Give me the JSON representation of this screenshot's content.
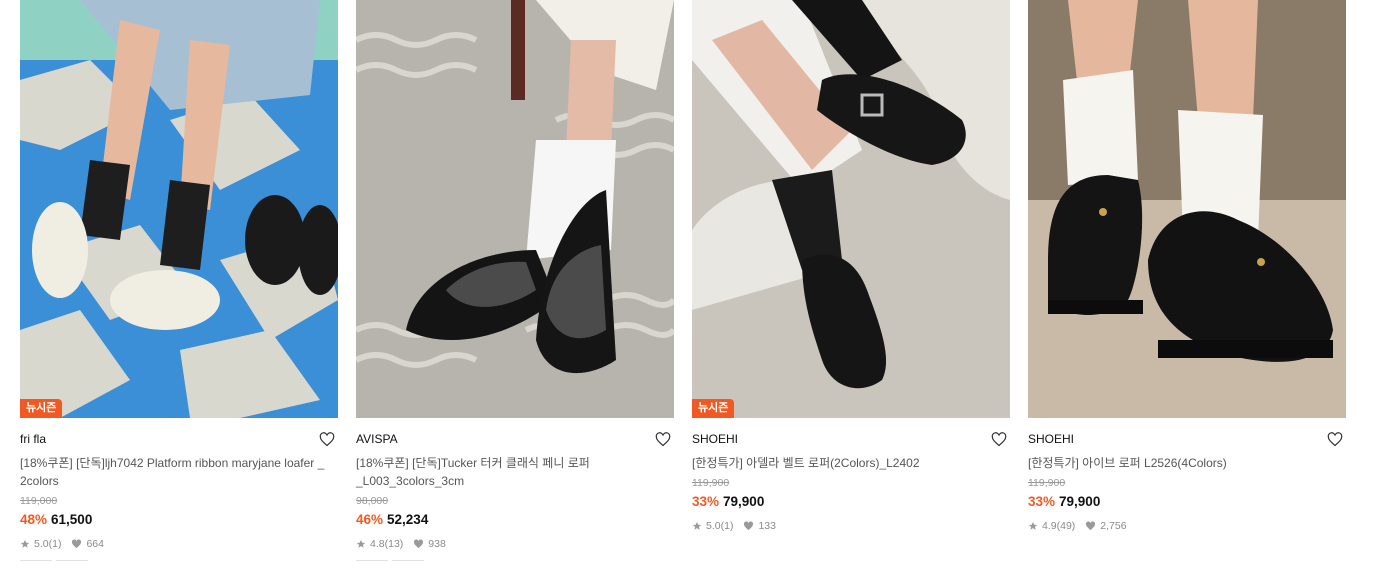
{
  "products": [
    {
      "brand": "fri fla",
      "badge": "뉴시즌",
      "name": "[18%쿠폰] [단독]ljh7042 Platform ribbon maryjane loafer _ 2colors",
      "original_price": "119,000",
      "discount": "48%",
      "price": "61,500",
      "rating": "5.0",
      "review_count": "(1)",
      "likes": "664",
      "icons": {
        "wish": "heart-outline-icon",
        "rating": "star-icon",
        "likes": "heart-filled-icon"
      }
    },
    {
      "brand": "AVISPA",
      "badge": "",
      "name": "[18%쿠폰] [단독]Tucker 터커 클래식 페니 로퍼 _L003_3colors_3cm",
      "original_price": "98,000",
      "discount": "46%",
      "price": "52,234",
      "rating": "4.8",
      "review_count": "(13)",
      "likes": "938",
      "icons": {
        "wish": "heart-outline-icon",
        "rating": "star-icon",
        "likes": "heart-filled-icon"
      }
    },
    {
      "brand": "SHOEHI",
      "badge": "뉴시즌",
      "name": "[한정특가] 아델라 벨트 로퍼(2Colors)_L2402",
      "original_price": "119,900",
      "discount": "33%",
      "price": "79,900",
      "rating": "5.0",
      "review_count": "(1)",
      "likes": "133",
      "icons": {
        "wish": "heart-outline-icon",
        "rating": "star-icon",
        "likes": "heart-filled-icon"
      }
    },
    {
      "brand": "SHOEHI",
      "badge": "",
      "name": "[한정특가] 아이브 로퍼 L2526(4Colors)",
      "original_price": "119,900",
      "discount": "33%",
      "price": "79,900",
      "rating": "4.9",
      "review_count": "(49)",
      "likes": "2,756",
      "icons": {
        "wish": "heart-outline-icon",
        "rating": "star-icon",
        "likes": "heart-filled-icon"
      }
    }
  ],
  "colors": {
    "accent": "#f05a22",
    "text": "#111111",
    "muted": "#8a8a8a"
  }
}
